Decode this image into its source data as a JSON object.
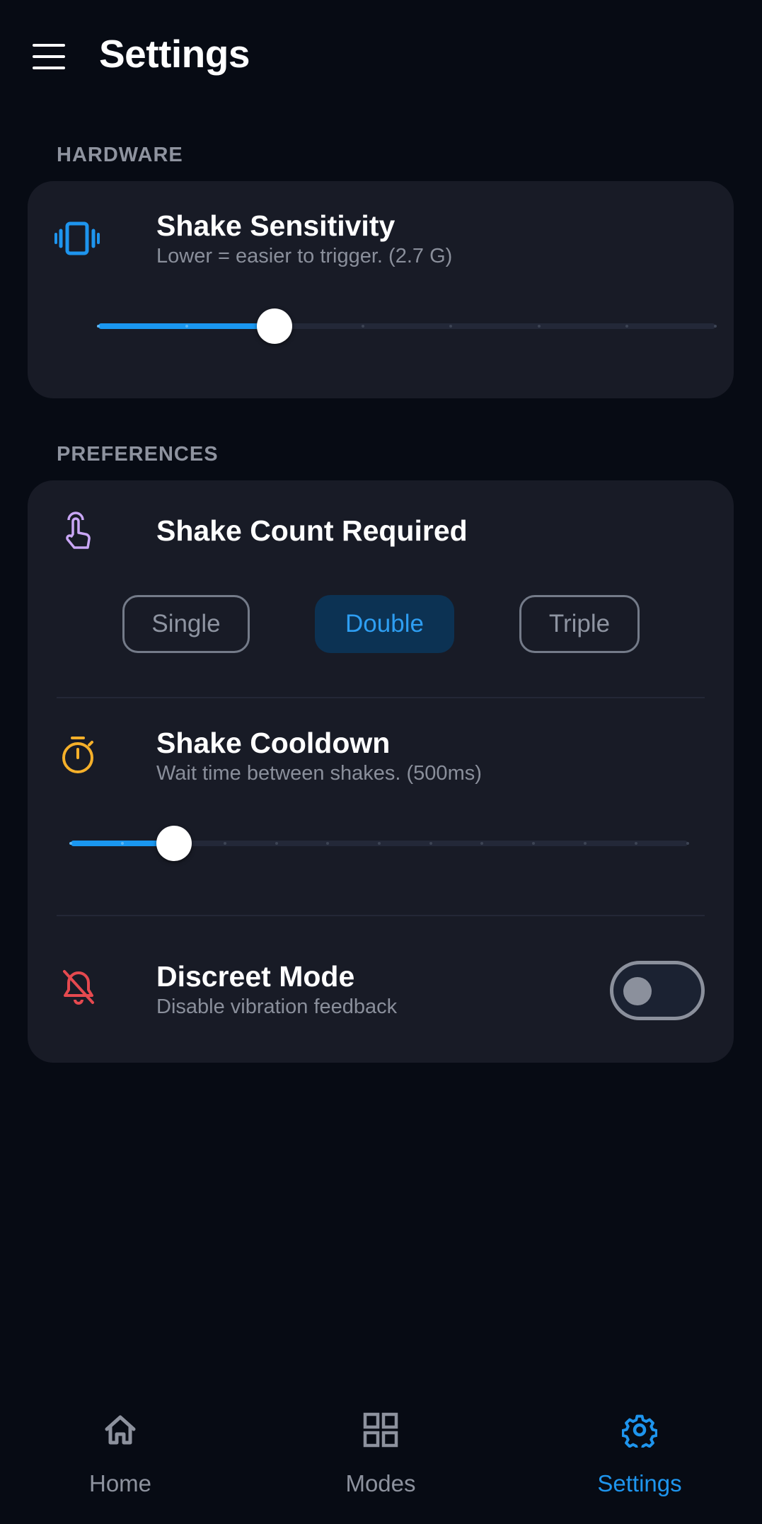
{
  "header": {
    "title": "Settings",
    "menu_icon": "hamburger-menu-icon"
  },
  "sections": {
    "hardware": {
      "label": "HARDWARE",
      "shake_sensitivity": {
        "icon": "vibration-icon",
        "icon_color": "#1e95ee",
        "title": "Shake Sensitivity",
        "subtitle": "Lower = easier to trigger. (2.7 G)",
        "slider_fraction": 0.286,
        "steps": 8
      }
    },
    "preferences": {
      "label": "PREFERENCES",
      "shake_count": {
        "icon": "tap-gesture-icon",
        "icon_color": "#c9a6f5",
        "title": "Shake Count Required",
        "options": [
          "Single",
          "Double",
          "Triple"
        ],
        "selected": "Double"
      },
      "shake_cooldown": {
        "icon": "stopwatch-icon",
        "icon_color": "#f5b02a",
        "title": "Shake Cooldown",
        "subtitle": "Wait time between shakes. (500ms)",
        "slider_fraction": 0.167,
        "steps": 13
      },
      "discreet_mode": {
        "icon": "bell-off-icon",
        "icon_color": "#e5494f",
        "title": "Discreet Mode",
        "subtitle": "Disable vibration feedback",
        "enabled": false
      }
    }
  },
  "bottom_nav": {
    "items": [
      {
        "label": "Home",
        "icon": "home-icon"
      },
      {
        "label": "Modes",
        "icon": "grid-icon"
      },
      {
        "label": "Settings",
        "icon": "gear-icon"
      }
    ],
    "active": "Settings"
  },
  "colors": {
    "background": "#070b14",
    "card": "#181b26",
    "accent": "#1e95ee"
  }
}
